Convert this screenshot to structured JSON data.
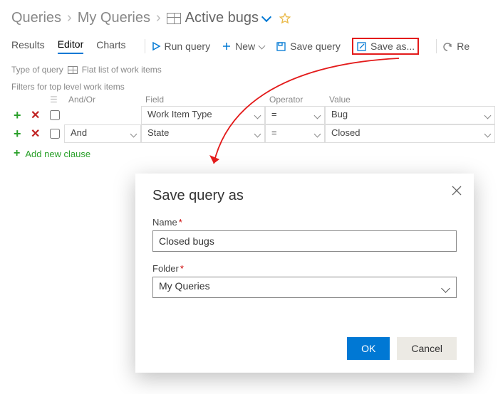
{
  "breadcrumb": {
    "root": "Queries",
    "mid": "My Queries",
    "leaf": "Active bugs"
  },
  "tabs": {
    "results": "Results",
    "editor": "Editor",
    "charts": "Charts"
  },
  "commands": {
    "run": "Run query",
    "new": "New",
    "save": "Save query",
    "saveas": "Save as...",
    "revert": "Re"
  },
  "subrow": {
    "label": "Type of query",
    "value": "Flat list of work items"
  },
  "filters": {
    "header": "Filters for top level work items",
    "cols": {
      "andor": "And/Or",
      "field": "Field",
      "op": "Operator",
      "value": "Value"
    },
    "rows": [
      {
        "andor": "",
        "field": "Work Item Type",
        "op": "=",
        "value": "Bug"
      },
      {
        "andor": "And",
        "field": "State",
        "op": "=",
        "value": "Closed"
      }
    ],
    "addnew": "Add new clause"
  },
  "dialog": {
    "title": "Save query as",
    "name_label": "Name",
    "name_value": "Closed bugs",
    "folder_label": "Folder",
    "folder_value": "My Queries",
    "ok": "OK",
    "cancel": "Cancel"
  }
}
